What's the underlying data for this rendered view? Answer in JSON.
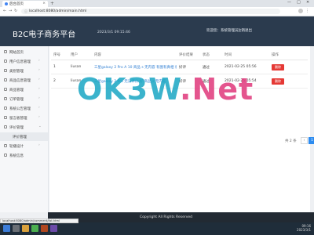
{
  "browser": {
    "tab_title": "后台首页",
    "url": "localhost:8080/admin/main.html"
  },
  "header": {
    "brand": "B2C电子商务平台",
    "clock": "2023/3/1 09:15:46",
    "welcome": "欢迎您：系统管理员",
    "logout": "注销退出"
  },
  "sidebar": {
    "items": [
      {
        "label": "网站首页"
      },
      {
        "label": "用户信息管理"
      },
      {
        "label": "类别管理"
      },
      {
        "label": "商品信息管理"
      },
      {
        "label": "商品管理"
      },
      {
        "label": "订单管理"
      },
      {
        "label": "系统公告管理"
      },
      {
        "label": "留言板管理"
      },
      {
        "label": "评价管理"
      },
      {
        "label": "评价管理"
      },
      {
        "label": "轮播设计"
      },
      {
        "label": "系统信息"
      }
    ]
  },
  "table": {
    "columns": [
      "序号",
      "用户",
      "内容",
      "评价结果",
      "状态",
      "时间",
      "操作"
    ],
    "rows": [
      {
        "index": "1",
        "user": "liusan",
        "content": "三星galaxy 2 Pro A 10 商品 s 无内容 有图有真相 很不错！",
        "result": "好评",
        "status": "通过",
        "time": "2021-02-25 05:56",
        "action": "删除"
      },
      {
        "index": "2",
        "user": "liusan",
        "content": "三星galaxy 2 Pro 无法评价 好 商品 s 无内容",
        "result": "好评",
        "status": "通过",
        "time": "2021-02-25 05:54",
        "action": "删除"
      }
    ]
  },
  "pager": {
    "total": "共 2 条",
    "prev": "‹",
    "current": "1",
    "next": "›"
  },
  "footer": {
    "copyright": "Copyright All Rights Reserved"
  },
  "status_bar": {
    "text": "localhost:8080/admin/comment/list.html"
  },
  "taskbar": {
    "time": "09:16",
    "date": "2023/3/1"
  },
  "watermark": {
    "part1": "OK3W",
    "part2": ".Net"
  },
  "colors": {
    "header_bg": "#2b3b4e",
    "delete_button": "#e53935",
    "page_active": "#2d8cf0"
  }
}
